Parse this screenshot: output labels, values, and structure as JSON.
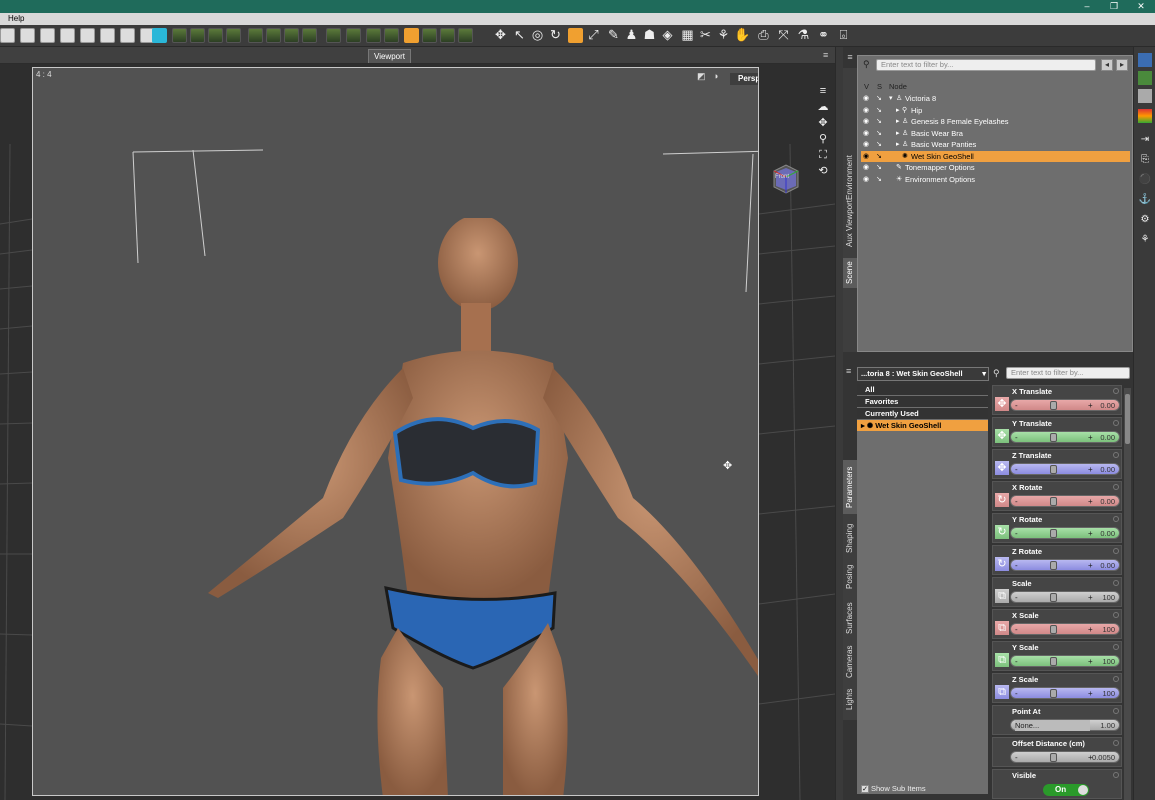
{
  "window": {
    "minimize": "–",
    "maximize": "❐",
    "close": "✕"
  },
  "menu": {
    "help": "Help"
  },
  "viewport": {
    "tab_label": "Viewport",
    "ratio": "4 : 4",
    "camera": "Perspective V...",
    "camera_arrow": "▾",
    "viewcube_face": "Front"
  },
  "scene": {
    "filter_placeholder": "Enter text to filter by...",
    "columns": {
      "v": "V",
      "s": "S",
      "node": "Node"
    },
    "nodes": [
      {
        "label": "Victoria 8",
        "indent": 0,
        "icon": "figure-icon",
        "expand": "▾"
      },
      {
        "label": "Hip",
        "indent": 1,
        "icon": "bone-icon",
        "expand": "▸"
      },
      {
        "label": "Genesis 8 Female Eyelashes",
        "indent": 1,
        "icon": "figure-icon",
        "expand": "▸"
      },
      {
        "label": "Basic Wear Bra",
        "indent": 1,
        "icon": "figure-icon",
        "expand": "▸"
      },
      {
        "label": "Basic Wear Panties",
        "indent": 1,
        "icon": "figure-icon",
        "expand": "▸"
      },
      {
        "label": "Wet Skin GeoShell",
        "indent": 1,
        "icon": "geoshell-icon",
        "expand": "",
        "selected": true
      },
      {
        "label": "Tonemapper Options",
        "indent": 0,
        "icon": "tonemapper-icon",
        "expand": ""
      },
      {
        "label": "Environment Options",
        "indent": 0,
        "icon": "environment-icon",
        "expand": ""
      }
    ],
    "tabs": [
      "Environment",
      "Aux Viewport",
      "Scene"
    ]
  },
  "parameters": {
    "path": "...toria 8 : Wet Skin GeoShell",
    "path_arrow": "▾",
    "filter_placeholder": "Enter text to filter by...",
    "categories": [
      "All",
      "Favorites",
      "Currently Used",
      "Wet Skin GeoShell"
    ],
    "show_sub_items": "Show Sub Items",
    "tabs": [
      "Parameters",
      "Shaping",
      "Posing",
      "Surfaces",
      "Cameras",
      "Lights"
    ],
    "items": [
      {
        "name": "X Translate",
        "value": "0.00",
        "color": "red",
        "icon": "move-icon"
      },
      {
        "name": "Y Translate",
        "value": "0.00",
        "color": "green",
        "icon": "move-icon"
      },
      {
        "name": "Z Translate",
        "value": "0.00",
        "color": "blue",
        "icon": "move-icon"
      },
      {
        "name": "X Rotate",
        "value": "0.00",
        "color": "red",
        "icon": "rotate-icon"
      },
      {
        "name": "Y Rotate",
        "value": "0.00",
        "color": "green",
        "icon": "rotate-icon"
      },
      {
        "name": "Z Rotate",
        "value": "0.00",
        "color": "blue",
        "icon": "rotate-icon"
      },
      {
        "name": "Scale",
        "value": "100",
        "color": "grey",
        "icon": "scale-icon"
      },
      {
        "name": "X Scale",
        "value": "100",
        "color": "red",
        "icon": "scale-icon"
      },
      {
        "name": "Y Scale",
        "value": "100",
        "color": "green",
        "icon": "scale-icon"
      },
      {
        "name": "Z Scale",
        "value": "100",
        "color": "blue",
        "icon": "scale-icon"
      },
      {
        "name": "Point At",
        "value": "1.00",
        "color": "grey",
        "icon": "",
        "select": "None..."
      },
      {
        "name": "Offset Distance (cm)",
        "value": "0.0050",
        "color": "grey",
        "icon": ""
      },
      {
        "name": "Visible",
        "value": "On",
        "color": "toggle",
        "icon": ""
      }
    ]
  },
  "colors": {
    "titlebar": "#1f6b5b",
    "selection": "#f0a040",
    "panel_bg": "#6e6e6e"
  }
}
